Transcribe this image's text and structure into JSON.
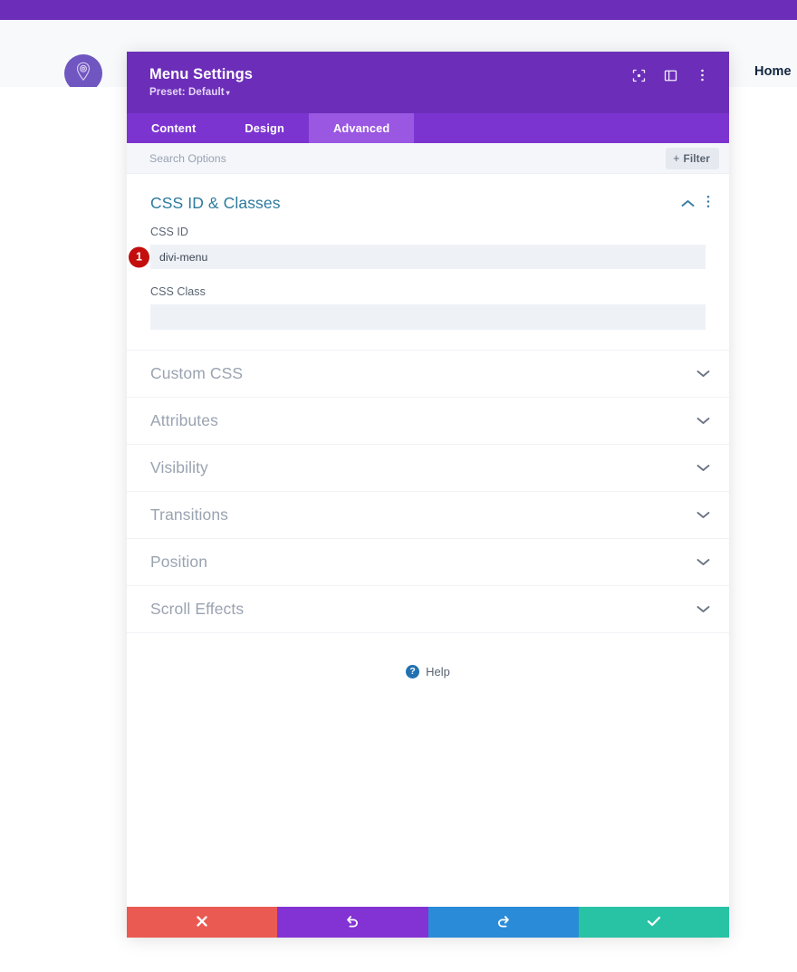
{
  "page": {
    "admin_bar_color": "#6c2eb9",
    "nav": {
      "home_label": "Home"
    },
    "logo_icon": "map-pin-icon"
  },
  "modal": {
    "title": "Menu Settings",
    "preset_label": "Preset: Default",
    "preset_caret": "▾",
    "header_icons": [
      {
        "name": "focus-target-icon"
      },
      {
        "name": "split-panel-icon"
      },
      {
        "name": "more-vertical-icon"
      }
    ],
    "tabs": [
      {
        "label": "Content",
        "active": false
      },
      {
        "label": "Design",
        "active": false
      },
      {
        "label": "Advanced",
        "active": true
      }
    ],
    "search": {
      "placeholder": "Search Options",
      "value": ""
    },
    "filter_button": {
      "plus": "+",
      "label": "Filter"
    },
    "open_section": {
      "title": "CSS ID & Classes",
      "collapse_icon": "chevron-up-icon",
      "menu_icon": "more-vertical-icon",
      "fields": [
        {
          "label": "CSS ID",
          "value": "divi-menu",
          "placeholder": "",
          "badge": "1"
        },
        {
          "label": "CSS Class",
          "value": "",
          "placeholder": "",
          "badge": ""
        }
      ]
    },
    "sections": [
      {
        "title": "Custom CSS",
        "expand_icon": "chevron-down-icon"
      },
      {
        "title": "Attributes",
        "expand_icon": "chevron-down-icon"
      },
      {
        "title": "Visibility",
        "expand_icon": "chevron-down-icon"
      },
      {
        "title": "Transitions",
        "expand_icon": "chevron-down-icon"
      },
      {
        "title": "Position",
        "expand_icon": "chevron-down-icon"
      },
      {
        "title": "Scroll Effects",
        "expand_icon": "chevron-down-icon"
      }
    ],
    "help": {
      "icon": "question-circle-icon",
      "glyph": "?",
      "label": "Help"
    },
    "footer_buttons": [
      {
        "name": "discard-button",
        "icon": "close-x-icon",
        "color": "#ea5a52"
      },
      {
        "name": "undo-button",
        "icon": "undo-icon",
        "color": "#8332d4"
      },
      {
        "name": "redo-button",
        "icon": "redo-icon",
        "color": "#2a8bd8"
      },
      {
        "name": "save-button",
        "icon": "checkmark-icon",
        "color": "#28c2a4"
      }
    ]
  }
}
